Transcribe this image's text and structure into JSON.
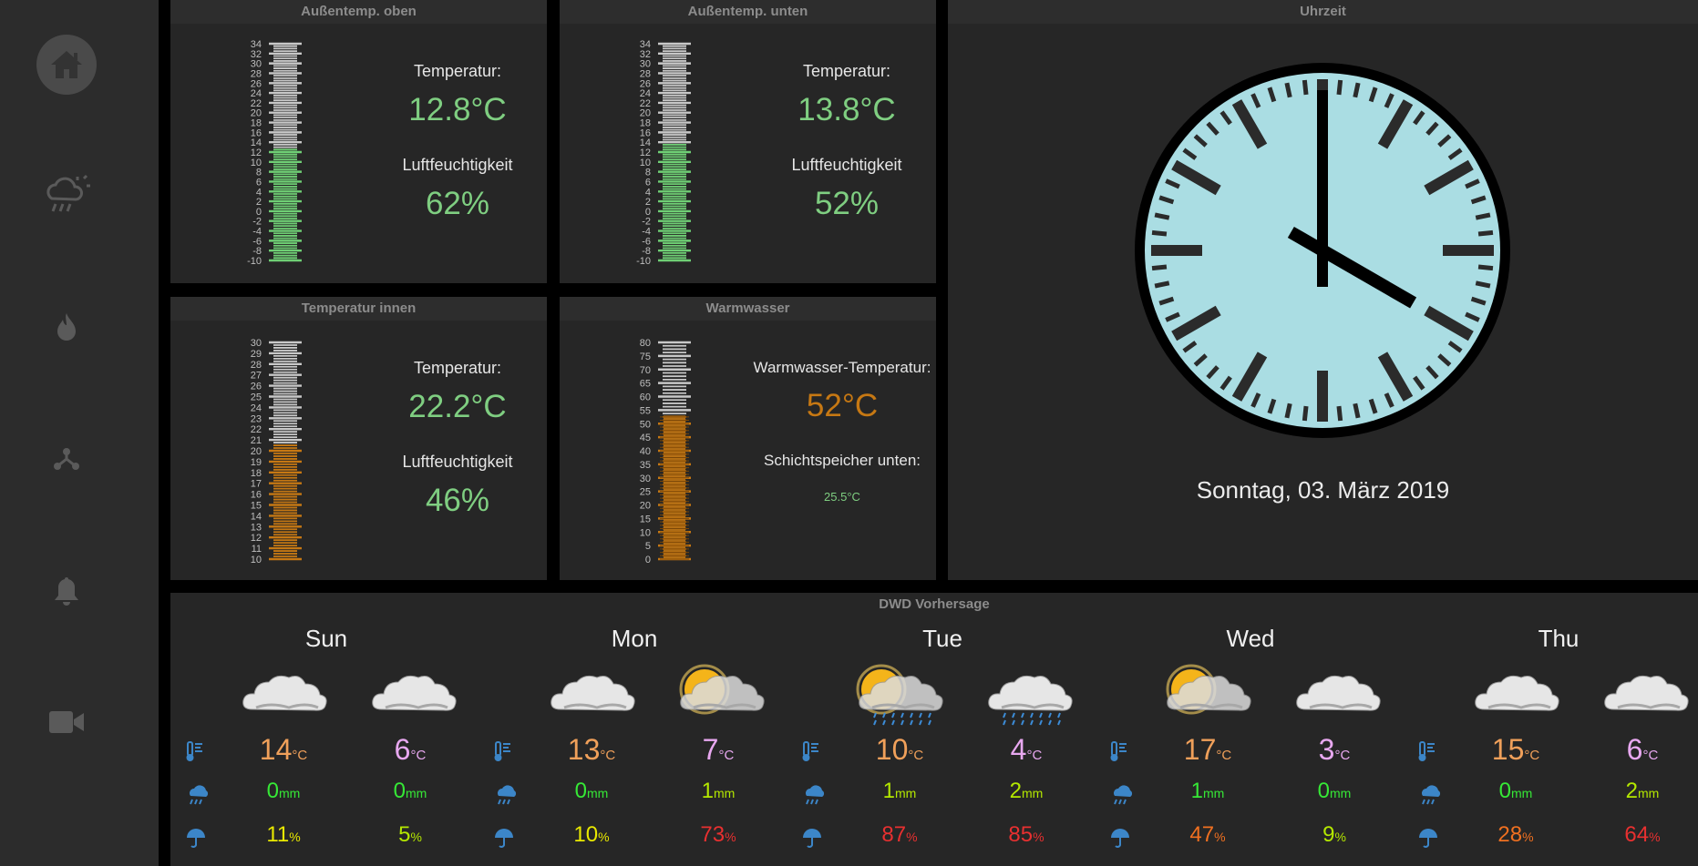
{
  "sidebar": {
    "items": [
      {
        "id": "home",
        "icon": "home-icon",
        "active": true
      },
      {
        "id": "weather",
        "icon": "cloud-rain-sun-icon",
        "active": false
      },
      {
        "id": "heating",
        "icon": "flame-icon",
        "active": false
      },
      {
        "id": "network",
        "icon": "network-icon",
        "active": false
      },
      {
        "id": "alarm",
        "icon": "bell-icon",
        "active": false
      },
      {
        "id": "camera",
        "icon": "video-camera-icon",
        "active": false
      }
    ]
  },
  "panels": {
    "outdoor_top": {
      "title": "Außentemp. oben",
      "temp_label": "Temperatur:",
      "temp_value": "12.8°C",
      "humidity_label": "Luftfeuchtigkeit",
      "humidity_value": "62%",
      "scale_min": -10,
      "scale_max": 34,
      "value": 12.8,
      "ticks": [
        "34",
        "32",
        "30",
        "28",
        "26",
        "24",
        "22",
        "20",
        "18",
        "16",
        "14",
        "12",
        "10",
        "8",
        "6",
        "4",
        "2",
        "0",
        "-2",
        "-4",
        "-6",
        "-8",
        "-10"
      ]
    },
    "outdoor_bottom": {
      "title": "Außentemp. unten",
      "temp_label": "Temperatur:",
      "temp_value": "13.8°C",
      "humidity_label": "Luftfeuchtigkeit",
      "humidity_value": "52%",
      "scale_min": -10,
      "scale_max": 34,
      "value": 13.8,
      "ticks": [
        "34",
        "32",
        "30",
        "28",
        "26",
        "24",
        "22",
        "20",
        "18",
        "16",
        "14",
        "12",
        "10",
        "8",
        "6",
        "4",
        "2",
        "0",
        "-2",
        "-4",
        "-6",
        "-8",
        "-10"
      ]
    },
    "indoor": {
      "title": "Temperatur innen",
      "temp_label": "Temperatur:",
      "temp_value": "22.2°C",
      "humidity_label": "Luftfeuchtigkeit",
      "humidity_value": "46%",
      "scale_min": 10,
      "scale_max": 30,
      "value": 20.5,
      "ticks": [
        "30",
        "29",
        "28",
        "27",
        "26",
        "25",
        "24",
        "23",
        "22",
        "21",
        "20",
        "19",
        "18",
        "17",
        "16",
        "15",
        "14",
        "13",
        "12",
        "11",
        "10"
      ]
    },
    "hot_water": {
      "title": "Warmwasser",
      "temp_label": "Warmwasser-Temperatur:",
      "temp_value": "52°C",
      "storage_label": "Schichtspeicher unten:",
      "storage_value": "25.5°C",
      "scale_min": 0,
      "scale_max": 80,
      "value": 53,
      "ticks": [
        "80",
        "75",
        "70",
        "65",
        "60",
        "55",
        "50",
        "45",
        "40",
        "35",
        "30",
        "25",
        "20",
        "15",
        "10",
        "5",
        "0"
      ]
    },
    "clock": {
      "title": "Uhrzeit",
      "date": "Sonntag, 03. März 2019",
      "face_color": "#aadde3",
      "time": "16:00"
    }
  },
  "forecast": {
    "title": "DWD Vorhersage",
    "days": [
      {
        "day": "Sun",
        "icons": [
          "cloud-icon",
          "cloud-icon"
        ],
        "temps": [
          {
            "v": "14",
            "u": "°C",
            "c": "#f0a05a"
          },
          {
            "v": "6",
            "u": "°C",
            "c": "#e8a8f0"
          }
        ],
        "rain": [
          {
            "v": "0",
            "u": "mm",
            "c": "#36e836"
          },
          {
            "v": "0",
            "u": "mm",
            "c": "#36e836"
          }
        ],
        "prob": [
          {
            "v": "11",
            "u": "%",
            "c": "#e8e800"
          },
          {
            "v": "5",
            "u": "%",
            "c": "#b4e800"
          }
        ]
      },
      {
        "day": "Mon",
        "icons": [
          "cloud-icon",
          "sun-cloud-icon"
        ],
        "temps": [
          {
            "v": "13",
            "u": "°C",
            "c": "#f0a05a"
          },
          {
            "v": "7",
            "u": "°C",
            "c": "#e8a8f0"
          }
        ],
        "rain": [
          {
            "v": "0",
            "u": "mm",
            "c": "#36e836"
          },
          {
            "v": "1",
            "u": "mm",
            "c": "#b4e800"
          }
        ],
        "prob": [
          {
            "v": "10",
            "u": "%",
            "c": "#e8e800"
          },
          {
            "v": "73",
            "u": "%",
            "c": "#e83030"
          }
        ]
      },
      {
        "day": "Tue",
        "icons": [
          "sun-cloud-rain-icon",
          "cloud-rain-icon"
        ],
        "temps": [
          {
            "v": "10",
            "u": "°C",
            "c": "#f0a05a"
          },
          {
            "v": "4",
            "u": "°C",
            "c": "#e8a8f0"
          }
        ],
        "rain": [
          {
            "v": "1",
            "u": "mm",
            "c": "#b4e800"
          },
          {
            "v": "2",
            "u": "mm",
            "c": "#b4e800"
          }
        ],
        "prob": [
          {
            "v": "87",
            "u": "%",
            "c": "#e83030"
          },
          {
            "v": "85",
            "u": "%",
            "c": "#e83030"
          }
        ]
      },
      {
        "day": "Wed",
        "icons": [
          "sun-cloud-icon",
          "cloud-icon"
        ],
        "temps": [
          {
            "v": "17",
            "u": "°C",
            "c": "#f0a05a"
          },
          {
            "v": "3",
            "u": "°C",
            "c": "#e8a8f0"
          }
        ],
        "rain": [
          {
            "v": "1",
            "u": "mm",
            "c": "#36e836"
          },
          {
            "v": "0",
            "u": "mm",
            "c": "#36e836"
          }
        ],
        "prob": [
          {
            "v": "47",
            "u": "%",
            "c": "#f07020"
          },
          {
            "v": "9",
            "u": "%",
            "c": "#b4e800"
          }
        ]
      },
      {
        "day": "Thu",
        "icons": [
          "cloud-icon",
          "cloud-icon"
        ],
        "temps": [
          {
            "v": "15",
            "u": "°C",
            "c": "#f0a05a"
          },
          {
            "v": "6",
            "u": "°C",
            "c": "#e8a8f0"
          }
        ],
        "rain": [
          {
            "v": "0",
            "u": "mm",
            "c": "#36e836"
          },
          {
            "v": "2",
            "u": "mm",
            "c": "#b4e800"
          }
        ],
        "prob": [
          {
            "v": "28",
            "u": "%",
            "c": "#f07020"
          },
          {
            "v": "64",
            "u": "%",
            "c": "#e83030"
          }
        ]
      }
    ]
  }
}
